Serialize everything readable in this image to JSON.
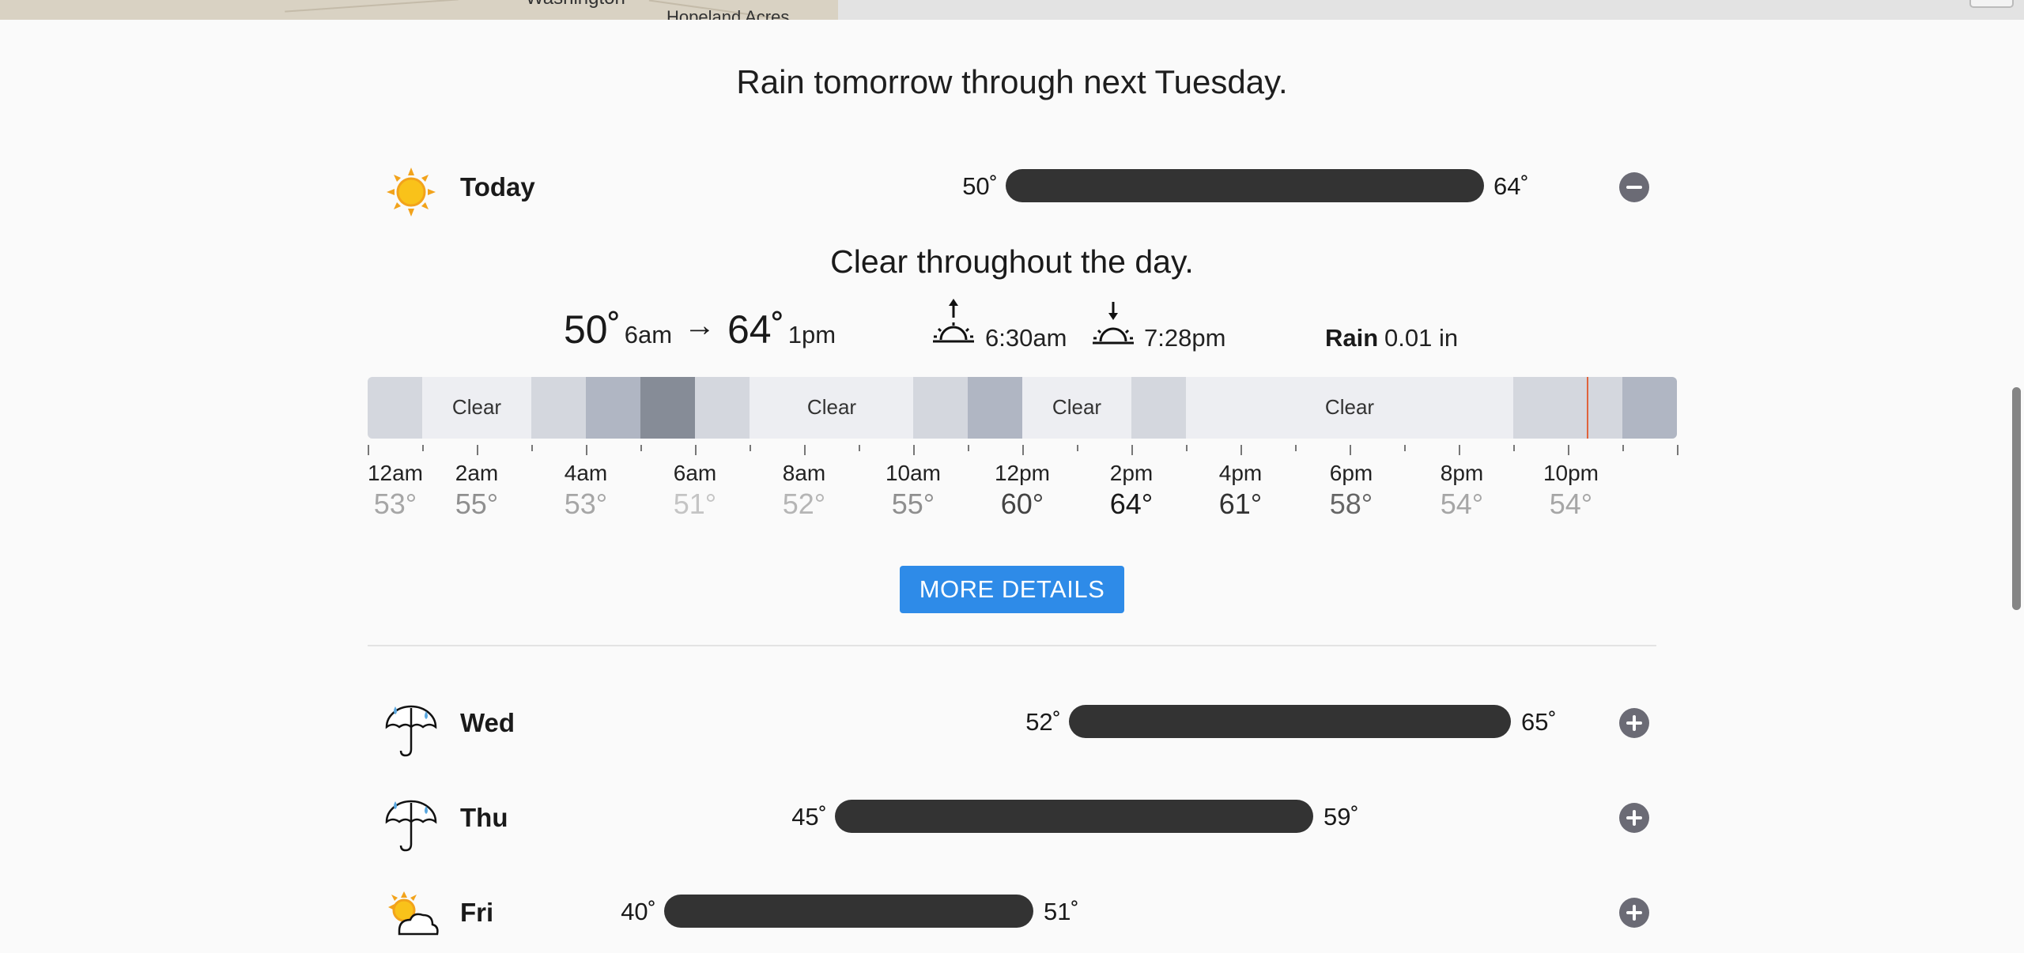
{
  "map": {
    "label_washington": "Washington",
    "label_hopeland": "Hopeland Acres"
  },
  "summary": "Rain tomorrow through next Tuesday.",
  "today": {
    "name": "Today",
    "icon": "sun-icon",
    "low": "50˚",
    "high": "64˚",
    "detail_summary": "Clear throughout the day.",
    "low_temp": "50˚",
    "low_time": "6am",
    "arrow": "→",
    "high_temp": "64˚",
    "high_time": "1pm",
    "sunrise": "6:30am",
    "sunset": "7:28pm",
    "rain_label": "Rain",
    "rain_value": "0.01 in",
    "timeline_labels": [
      "Clear",
      "Clear",
      "Clear",
      "Clear"
    ],
    "hours": [
      {
        "label": "12am",
        "temp": "53°"
      },
      {
        "label": "2am",
        "temp": "55°"
      },
      {
        "label": "4am",
        "temp": "53°"
      },
      {
        "label": "6am",
        "temp": "51°"
      },
      {
        "label": "8am",
        "temp": "52°"
      },
      {
        "label": "10am",
        "temp": "55°"
      },
      {
        "label": "12pm",
        "temp": "60°"
      },
      {
        "label": "2pm",
        "temp": "64°"
      },
      {
        "label": "4pm",
        "temp": "61°"
      },
      {
        "label": "6pm",
        "temp": "58°"
      },
      {
        "label": "8pm",
        "temp": "54°"
      },
      {
        "label": "10pm",
        "temp": "54°"
      }
    ],
    "more_details": "MORE DETAILS"
  },
  "days": [
    {
      "name": "Wed",
      "icon": "umbrella-rain-icon",
      "low": "52˚",
      "high": "65˚"
    },
    {
      "name": "Thu",
      "icon": "umbrella-rain-icon",
      "low": "45˚",
      "high": "59˚"
    },
    {
      "name": "Fri",
      "icon": "partly-cloudy-icon",
      "low": "40˚",
      "high": "51˚"
    }
  ],
  "colors": {
    "bar": "#333333",
    "button": "#2e8be8",
    "now_line": "#e0643c"
  }
}
